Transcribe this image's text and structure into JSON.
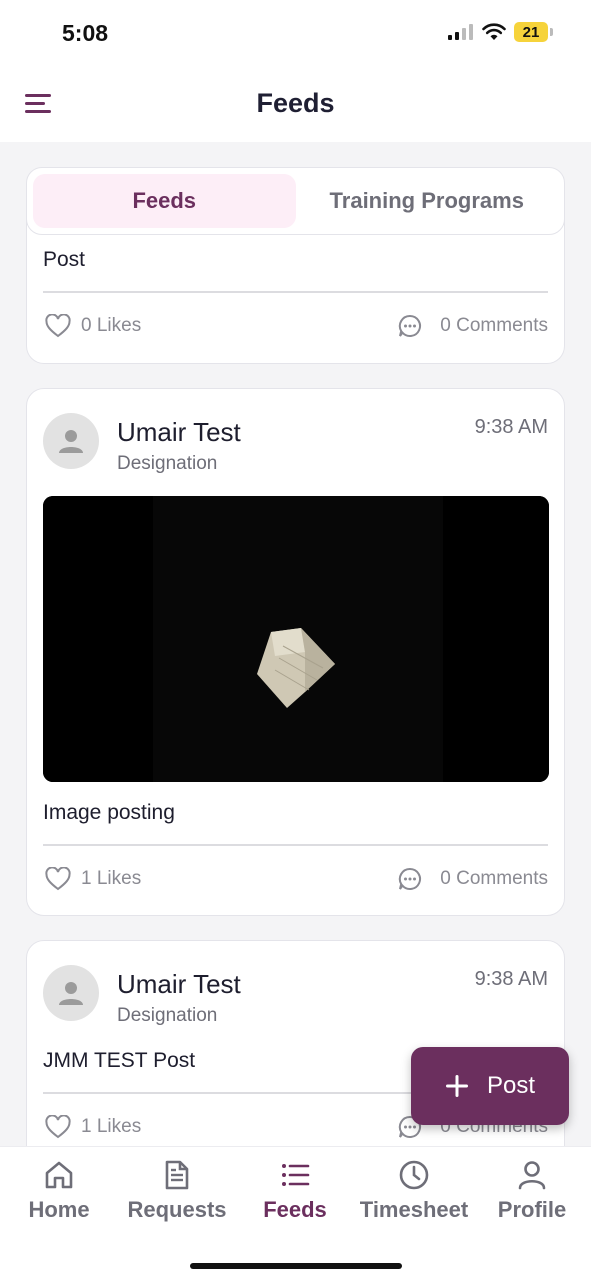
{
  "status_bar": {
    "time": "5:08",
    "battery": "21"
  },
  "header": {
    "title": "Feeds",
    "menu_icon": "hamburger-menu-icon"
  },
  "tabs": [
    {
      "label": "Feeds",
      "active": true
    },
    {
      "label": "Training Programs",
      "active": false
    }
  ],
  "posts": [
    {
      "text": "Post",
      "likes": "0 Likes",
      "comments": "0 Comments"
    },
    {
      "author": "Umair Test",
      "designation": "Designation",
      "time": "9:38 AM",
      "text": "Image posting",
      "likes": "1 Likes",
      "comments": "0 Comments",
      "has_media": true
    },
    {
      "author": "Umair Test",
      "designation": "Designation",
      "time": "9:38 AM",
      "text": "JMM TEST Post",
      "likes": "1 Likes",
      "comments": "0 Comments"
    }
  ],
  "fab": {
    "label": "Post",
    "icon": "plus-icon"
  },
  "bottom_nav": [
    {
      "label": "Home",
      "icon": "home-icon"
    },
    {
      "label": "Requests",
      "icon": "document-icon"
    },
    {
      "label": "Feeds",
      "icon": "list-icon",
      "active": true
    },
    {
      "label": "Timesheet",
      "icon": "clock-icon"
    },
    {
      "label": "Profile",
      "icon": "person-icon"
    }
  ],
  "colors": {
    "accent": "#6b2f5e",
    "tab_active_bg": "#fdeef7",
    "muted": "#8a8a92"
  }
}
